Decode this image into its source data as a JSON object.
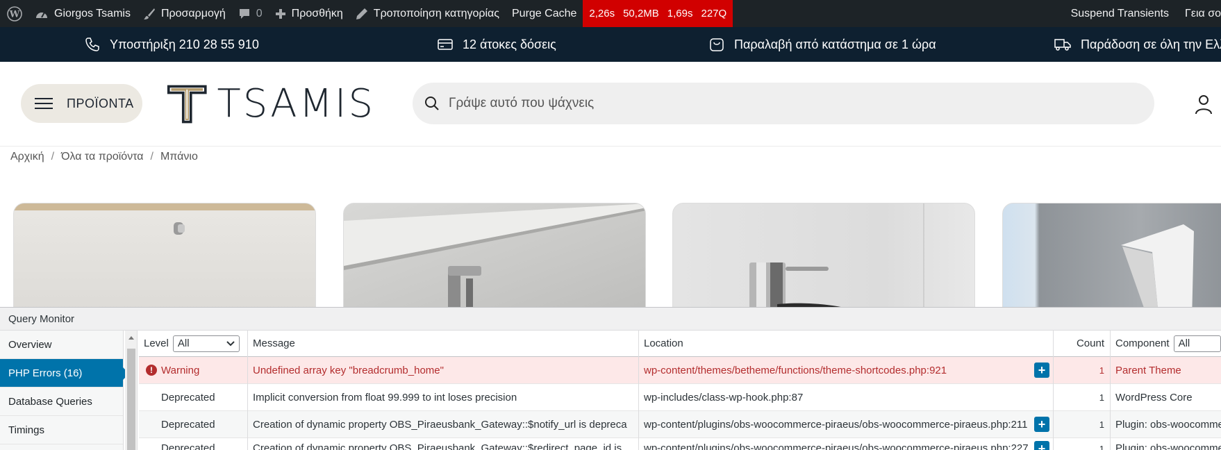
{
  "adminbar": {
    "site_name": "Giorgos Tsamis",
    "customize": "Προσαρμογή",
    "comments_count": "0",
    "new": "Προσθήκη",
    "edit": "Τροποποίηση κατηγορίας",
    "purge_cache": "Purge Cache",
    "perf": {
      "time": "2,26s",
      "memory": "50,2MB",
      "db_time": "1,69s",
      "queries": "227Q"
    },
    "suspend_transients": "Suspend Transients",
    "greeting": "Γεια σο"
  },
  "infobar": {
    "support": "Υποστήριξη 210 28 55 910",
    "installments": "12 άτοκες δόσεις",
    "pickup": "Παραλαβή από κατάστημα σε 1 ώρα",
    "delivery": "Παράδοση σε όλη την Ελλ"
  },
  "header": {
    "menu_label": "ΠΡΟΪΟΝΤΑ",
    "logo_text": "TSAMIS",
    "search_placeholder": "Γράψε αυτό που ψάχνεις"
  },
  "breadcrumb": [
    "Αρχική",
    "Όλα τα προϊόντα",
    "Μπάνιο"
  ],
  "colors": {
    "accent": "#0073aa",
    "perf_bg": "#d10000",
    "warning_bg": "#fde8e8",
    "warning_text": "#b32d2e"
  },
  "qm": {
    "title": "Query Monitor",
    "nav": [
      "Overview",
      "PHP Errors (16)",
      "Database Queries",
      "Timings"
    ],
    "headers": {
      "level": "Level",
      "level_filter": "All",
      "message": "Message",
      "location": "Location",
      "count": "Count",
      "component": "Component",
      "component_filter": "All"
    },
    "rows": [
      {
        "level": "Warning",
        "message": "Undefined array key \"breadcrumb_home\"",
        "location": "wp-content/themes/betheme/functions/theme-shortcodes.php:921",
        "count": "1",
        "component": "Parent Theme"
      },
      {
        "level": "Deprecated",
        "message": "Implicit conversion from float 99.999 to int loses precision",
        "location": "wp-includes/class-wp-hook.php:87",
        "count": "1",
        "component": "WordPress Core"
      },
      {
        "level": "Deprecated",
        "message": "Creation of dynamic property OBS_Piraeusbank_Gateway::$notify_url is deprecated",
        "location": "wp-content/plugins/obs-woocommerce-piraeus/obs-woocommerce-piraeus.php:211",
        "count": "1",
        "component": "Plugin: obs-woocomme"
      },
      {
        "level": "Deprecated",
        "message": "Creation of dynamic property OBS_Piraeusbank_Gateway::$redirect_page_id is",
        "location": "wp-content/plugins/obs-woocommerce-piraeus/obs-woocommerce-piraeus.php:227",
        "count": "1",
        "component": "Plugin: obs-woocomme"
      }
    ]
  }
}
